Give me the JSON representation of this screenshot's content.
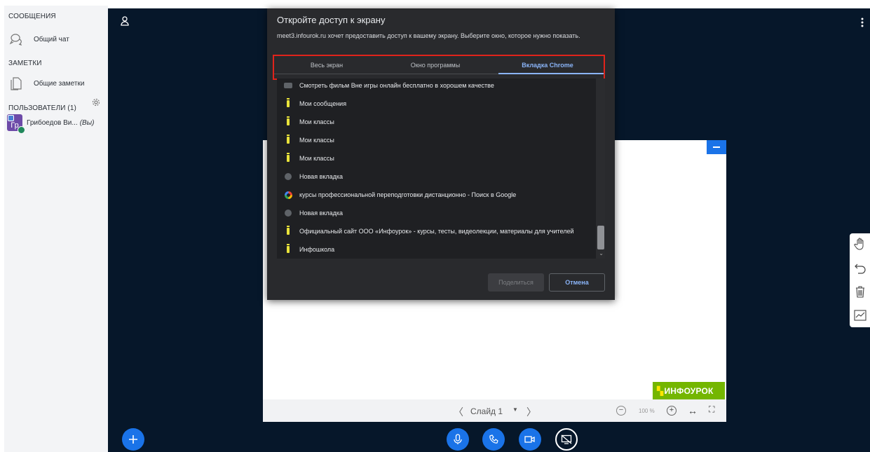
{
  "sidebar": {
    "messages_title": "СООБЩЕНИЯ",
    "public_chat": "Общий чат",
    "notes_title": "ЗАМЕТКИ",
    "shared_notes": "Общие заметки",
    "users_title": "ПОЛЬЗОВАТЕЛИ (1)",
    "user": {
      "initials": "Гр",
      "name": "Грибоедов Ви...",
      "you_label": "(Вы)"
    }
  },
  "dialog": {
    "title": "Откройте доступ к экрану",
    "description": "meet3.infourok.ru хочет предоставить доступ к вашему экрану. Выберите окно, которое нужно показать.",
    "tabs": [
      "Весь экран",
      "Окно программы",
      "Вкладка Chrome"
    ],
    "active_tab": "Вкладка Chrome",
    "items": [
      {
        "icon": "film-icon",
        "label": "Смотреть фильм Вне игры онлайн бесплатно в хорошем качестве"
      },
      {
        "icon": "infourok-icon",
        "label": "Мои сообщения"
      },
      {
        "icon": "infourok-icon",
        "label": "Мои классы"
      },
      {
        "icon": "infourok-icon",
        "label": "Мои классы"
      },
      {
        "icon": "infourok-icon",
        "label": "Мои классы"
      },
      {
        "icon": "globe-icon",
        "label": "Новая вкладка"
      },
      {
        "icon": "google-icon",
        "label": "курсы профессиональной переподготовки дистанционно - Поиск в Google"
      },
      {
        "icon": "globe-icon",
        "label": "Новая вкладка"
      },
      {
        "icon": "infourok-icon",
        "label": "Официальный сайт ООО «Инфоурок» - курсы, тесты, видеолекции, материалы для учителей"
      },
      {
        "icon": "infourok-icon",
        "label": "Инфошкола"
      }
    ],
    "share_label": "Поделиться",
    "cancel_label": "Отмена"
  },
  "presentation": {
    "slide_label": "Слайд 1",
    "zoom": "100 %",
    "logo_text": "ИНФОУРОК"
  },
  "colors": {
    "accent": "#1a73e8",
    "dark_background": "#06172a",
    "dialog_background": "#292a2d",
    "highlight_outline": "#e0231b",
    "logo_green": "#74b600"
  }
}
